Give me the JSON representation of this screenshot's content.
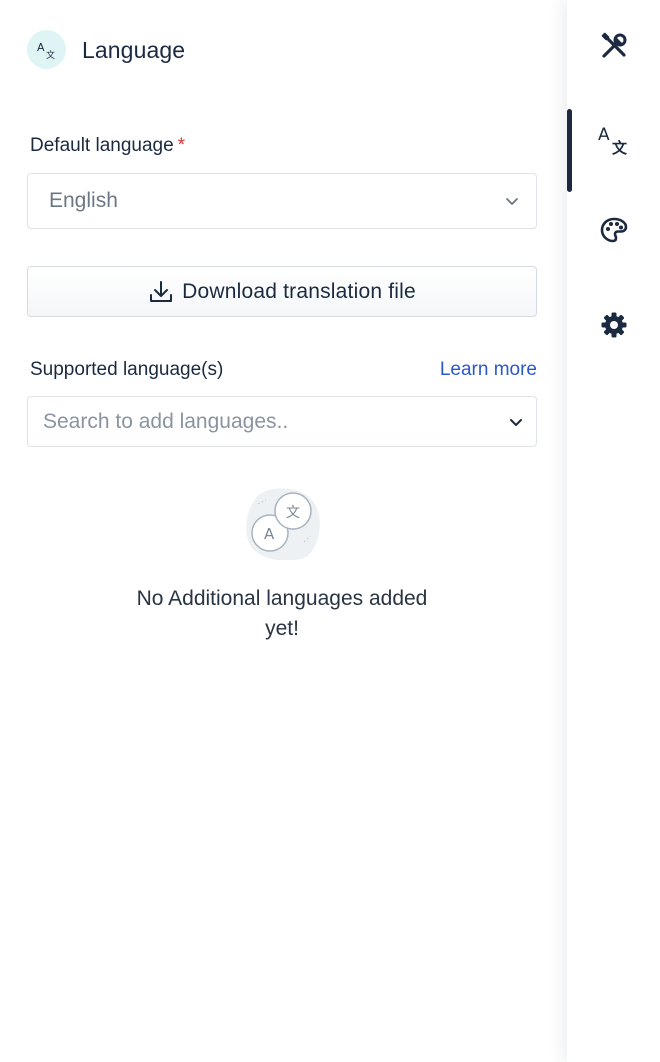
{
  "header": {
    "title": "Language",
    "icon": "translate-icon"
  },
  "default_language": {
    "label": "Default language",
    "required_marker": "*",
    "value": "English"
  },
  "download_button": {
    "label": "Download translation file",
    "icon": "download-icon"
  },
  "supported_languages": {
    "label": "Supported language(s)",
    "learn_more": "Learn more",
    "placeholder": "Search to add languages..",
    "empty_line1": "No Additional languages added",
    "empty_line2": "yet!"
  },
  "rail": {
    "items": [
      {
        "name": "tools",
        "icon": "tools-icon"
      },
      {
        "name": "language",
        "icon": "translate-icon",
        "active": true
      },
      {
        "name": "theme",
        "icon": "palette-icon"
      },
      {
        "name": "settings",
        "icon": "gear-icon"
      }
    ]
  },
  "colors": {
    "text": "#1b2a41",
    "link": "#2b58c8",
    "required": "#d93636",
    "icon_bg": "#dff4f4",
    "border": "#dfe3e8"
  }
}
